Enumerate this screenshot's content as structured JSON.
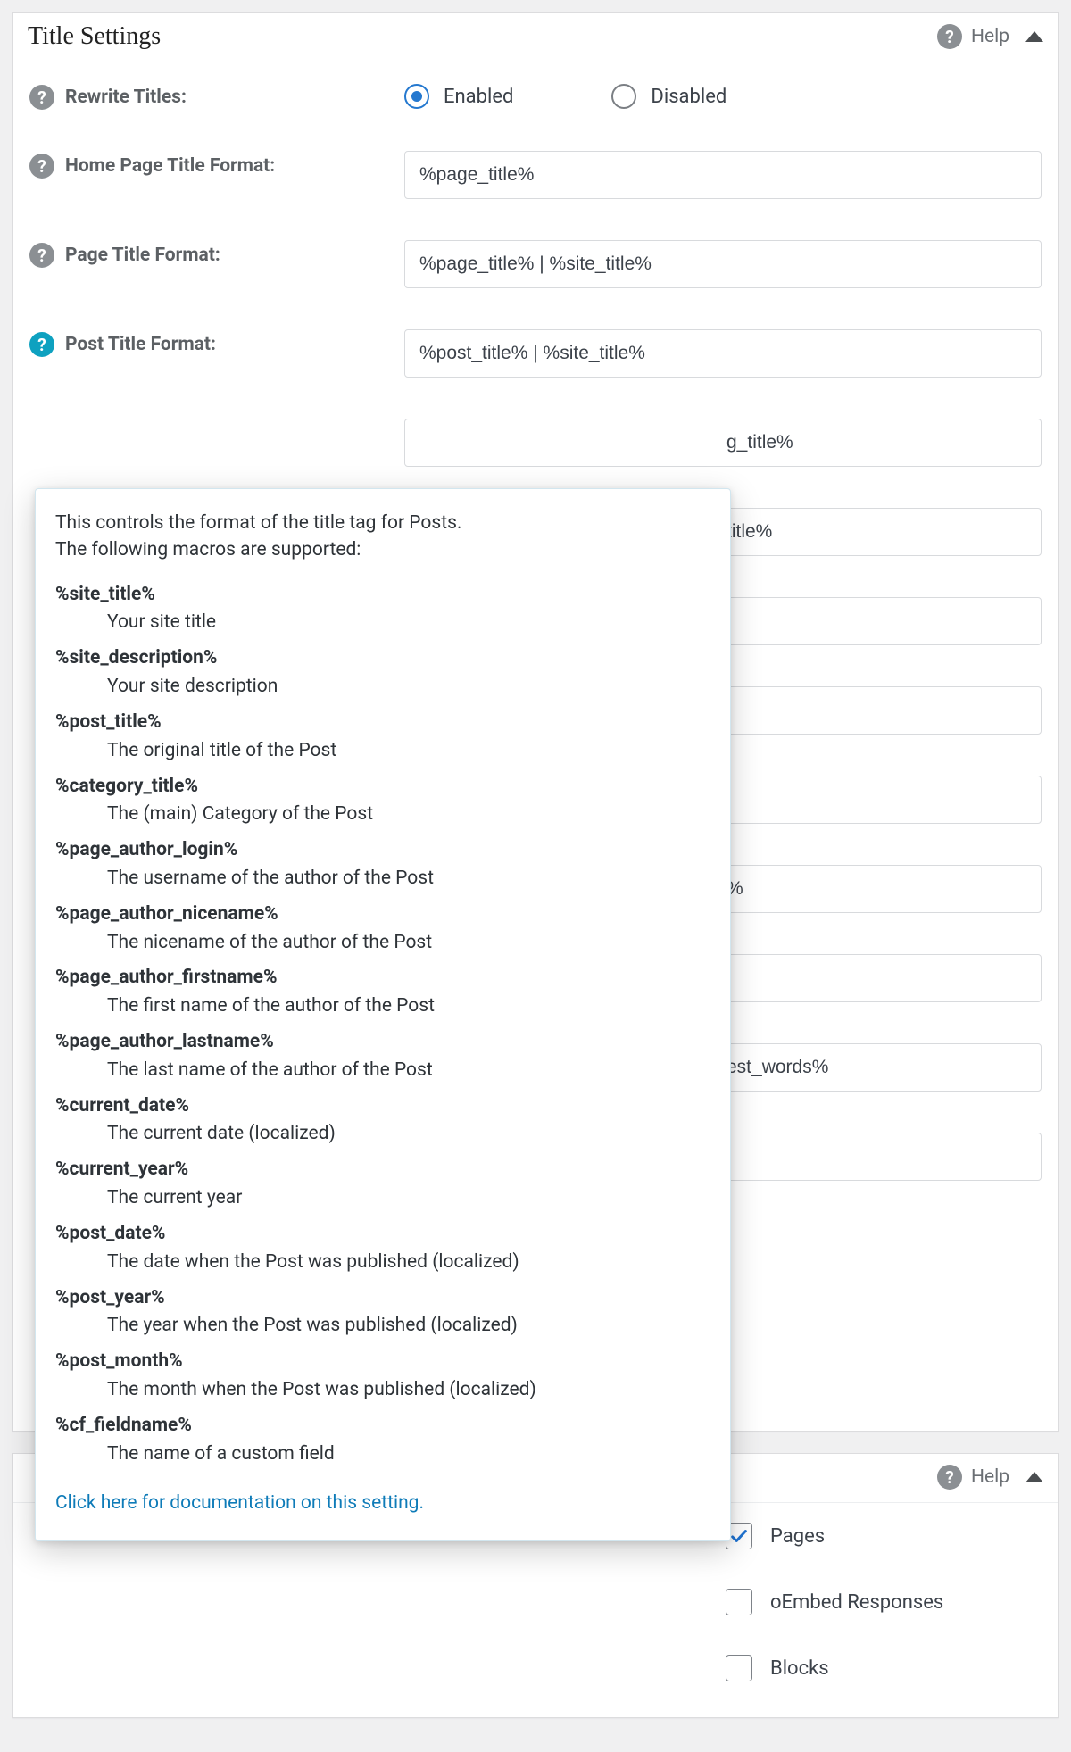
{
  "panel1": {
    "title": "Title Settings",
    "help_label": "Help"
  },
  "form": {
    "rewrite_titles": {
      "label": "Rewrite Titles:",
      "enabled_label": "Enabled",
      "disabled_label": "Disabled",
      "value": "enabled"
    },
    "home_page_title_format": {
      "label": "Home Page Title Format:",
      "value": "%page_title%"
    },
    "page_title_format": {
      "label": "Page Title Format:",
      "value": "%page_title% | %site_title%"
    },
    "post_title_format": {
      "label": "Post Title Format:",
      "value": "%post_title% | %site_title%"
    },
    "row5": {
      "value_tail": "g_title%"
    },
    "row6": {
      "value_tail": "title%"
    },
    "row7": {
      "value_tail": ""
    },
    "row8": {
      "value_tail": ""
    },
    "row9": {
      "value_tail": ""
    },
    "row10": {
      "value_tail": "%"
    },
    "row11": {
      "value_tail": ""
    },
    "row12": {
      "value_tail": "est_words%"
    },
    "row13": {
      "value_tail": ""
    }
  },
  "tooltip": {
    "intro_line1": "This controls the format of the title tag for Posts.",
    "intro_line2": "The following macros are supported:",
    "macros": [
      {
        "name": "%site_title%",
        "desc": "Your site title"
      },
      {
        "name": "%site_description%",
        "desc": "Your site description"
      },
      {
        "name": "%post_title%",
        "desc": "The original title of the Post"
      },
      {
        "name": "%category_title%",
        "desc": "The (main) Category of the Post"
      },
      {
        "name": "%page_author_login%",
        "desc": "The username of the author of the Post"
      },
      {
        "name": "%page_author_nicename%",
        "desc": "The nicename of the author of the Post"
      },
      {
        "name": "%page_author_firstname%",
        "desc": "The first name of the author of the Post"
      },
      {
        "name": "%page_author_lastname%",
        "desc": "The last name of the author of the Post"
      },
      {
        "name": "%current_date%",
        "desc": "The current date (localized)"
      },
      {
        "name": "%current_year%",
        "desc": "The current year"
      },
      {
        "name": "%post_date%",
        "desc": "The date when the Post was published (localized)"
      },
      {
        "name": "%post_year%",
        "desc": "The year when the Post was published (localized)"
      },
      {
        "name": "%post_month%",
        "desc": "The month when the Post was published (localized)"
      },
      {
        "name": "%cf_fieldname%",
        "desc": "The name of a custom field"
      }
    ],
    "doc_link": "Click here for documentation on this setting."
  },
  "panel2": {
    "help_label": "Help",
    "choices": [
      {
        "label": "Pages",
        "checked": true
      },
      {
        "label": "oEmbed Responses",
        "checked": false
      },
      {
        "label": "Blocks",
        "checked": false
      }
    ]
  }
}
